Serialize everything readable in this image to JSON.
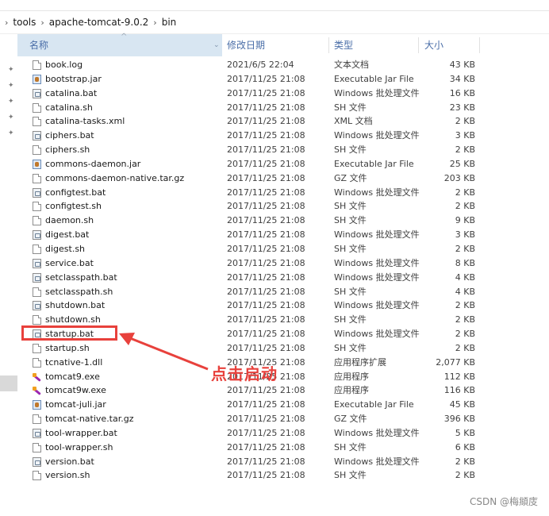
{
  "breadcrumb": [
    "tools",
    "apache-tomcat-9.0.2",
    "bin"
  ],
  "columns": {
    "name": "名称",
    "date": "修改日期",
    "type": "类型",
    "size": "大小"
  },
  "files": [
    {
      "name": "book.log",
      "date": "2021/6/5 22:04",
      "type": "文本文档",
      "size": "43 KB",
      "icon": "file"
    },
    {
      "name": "bootstrap.jar",
      "date": "2017/11/25 21:08",
      "type": "Executable Jar File",
      "size": "34 KB",
      "icon": "jar"
    },
    {
      "name": "catalina.bat",
      "date": "2017/11/25 21:08",
      "type": "Windows 批处理文件",
      "size": "16 KB",
      "icon": "bat"
    },
    {
      "name": "catalina.sh",
      "date": "2017/11/25 21:08",
      "type": "SH 文件",
      "size": "23 KB",
      "icon": "file"
    },
    {
      "name": "catalina-tasks.xml",
      "date": "2017/11/25 21:08",
      "type": "XML 文档",
      "size": "2 KB",
      "icon": "file"
    },
    {
      "name": "ciphers.bat",
      "date": "2017/11/25 21:08",
      "type": "Windows 批处理文件",
      "size": "3 KB",
      "icon": "bat"
    },
    {
      "name": "ciphers.sh",
      "date": "2017/11/25 21:08",
      "type": "SH 文件",
      "size": "2 KB",
      "icon": "file"
    },
    {
      "name": "commons-daemon.jar",
      "date": "2017/11/25 21:08",
      "type": "Executable Jar File",
      "size": "25 KB",
      "icon": "jar"
    },
    {
      "name": "commons-daemon-native.tar.gz",
      "date": "2017/11/25 21:08",
      "type": "GZ 文件",
      "size": "203 KB",
      "icon": "file"
    },
    {
      "name": "configtest.bat",
      "date": "2017/11/25 21:08",
      "type": "Windows 批处理文件",
      "size": "2 KB",
      "icon": "bat"
    },
    {
      "name": "configtest.sh",
      "date": "2017/11/25 21:08",
      "type": "SH 文件",
      "size": "2 KB",
      "icon": "file"
    },
    {
      "name": "daemon.sh",
      "date": "2017/11/25 21:08",
      "type": "SH 文件",
      "size": "9 KB",
      "icon": "file"
    },
    {
      "name": "digest.bat",
      "date": "2017/11/25 21:08",
      "type": "Windows 批处理文件",
      "size": "3 KB",
      "icon": "bat"
    },
    {
      "name": "digest.sh",
      "date": "2017/11/25 21:08",
      "type": "SH 文件",
      "size": "2 KB",
      "icon": "file"
    },
    {
      "name": "service.bat",
      "date": "2017/11/25 21:08",
      "type": "Windows 批处理文件",
      "size": "8 KB",
      "icon": "bat"
    },
    {
      "name": "setclasspath.bat",
      "date": "2017/11/25 21:08",
      "type": "Windows 批处理文件",
      "size": "4 KB",
      "icon": "bat"
    },
    {
      "name": "setclasspath.sh",
      "date": "2017/11/25 21:08",
      "type": "SH 文件",
      "size": "4 KB",
      "icon": "file"
    },
    {
      "name": "shutdown.bat",
      "date": "2017/11/25 21:08",
      "type": "Windows 批处理文件",
      "size": "2 KB",
      "icon": "bat"
    },
    {
      "name": "shutdown.sh",
      "date": "2017/11/25 21:08",
      "type": "SH 文件",
      "size": "2 KB",
      "icon": "file"
    },
    {
      "name": "startup.bat",
      "date": "2017/11/25 21:08",
      "type": "Windows 批处理文件",
      "size": "2 KB",
      "icon": "bat"
    },
    {
      "name": "startup.sh",
      "date": "2017/11/25 21:08",
      "type": "SH 文件",
      "size": "2 KB",
      "icon": "file"
    },
    {
      "name": "tcnative-1.dll",
      "date": "2017/11/25 21:08",
      "type": "应用程序扩展",
      "size": "2,077 KB",
      "icon": "file"
    },
    {
      "name": "tomcat9.exe",
      "date": "2017/11/25 21:08",
      "type": "应用程序",
      "size": "112 KB",
      "icon": "exe"
    },
    {
      "name": "tomcat9w.exe",
      "date": "2017/11/25 21:08",
      "type": "应用程序",
      "size": "116 KB",
      "icon": "exe"
    },
    {
      "name": "tomcat-juli.jar",
      "date": "2017/11/25 21:08",
      "type": "Executable Jar File",
      "size": "45 KB",
      "icon": "jar"
    },
    {
      "name": "tomcat-native.tar.gz",
      "date": "2017/11/25 21:08",
      "type": "GZ 文件",
      "size": "396 KB",
      "icon": "file"
    },
    {
      "name": "tool-wrapper.bat",
      "date": "2017/11/25 21:08",
      "type": "Windows 批处理文件",
      "size": "5 KB",
      "icon": "bat"
    },
    {
      "name": "tool-wrapper.sh",
      "date": "2017/11/25 21:08",
      "type": "SH 文件",
      "size": "6 KB",
      "icon": "file"
    },
    {
      "name": "version.bat",
      "date": "2017/11/25 21:08",
      "type": "Windows 批处理文件",
      "size": "2 KB",
      "icon": "bat"
    },
    {
      "name": "version.sh",
      "date": "2017/11/25 21:08",
      "type": "SH 文件",
      "size": "2 KB",
      "icon": "file"
    }
  ],
  "annotation": {
    "text": "点击启动",
    "target": "startup.bat",
    "color": "#e8413c"
  },
  "watermark": "CSDN @梅頫庋",
  "colors": {
    "header_bg": "#d8e6f2",
    "header_text": "#4a6ea8",
    "highlight": "#e8413c"
  }
}
